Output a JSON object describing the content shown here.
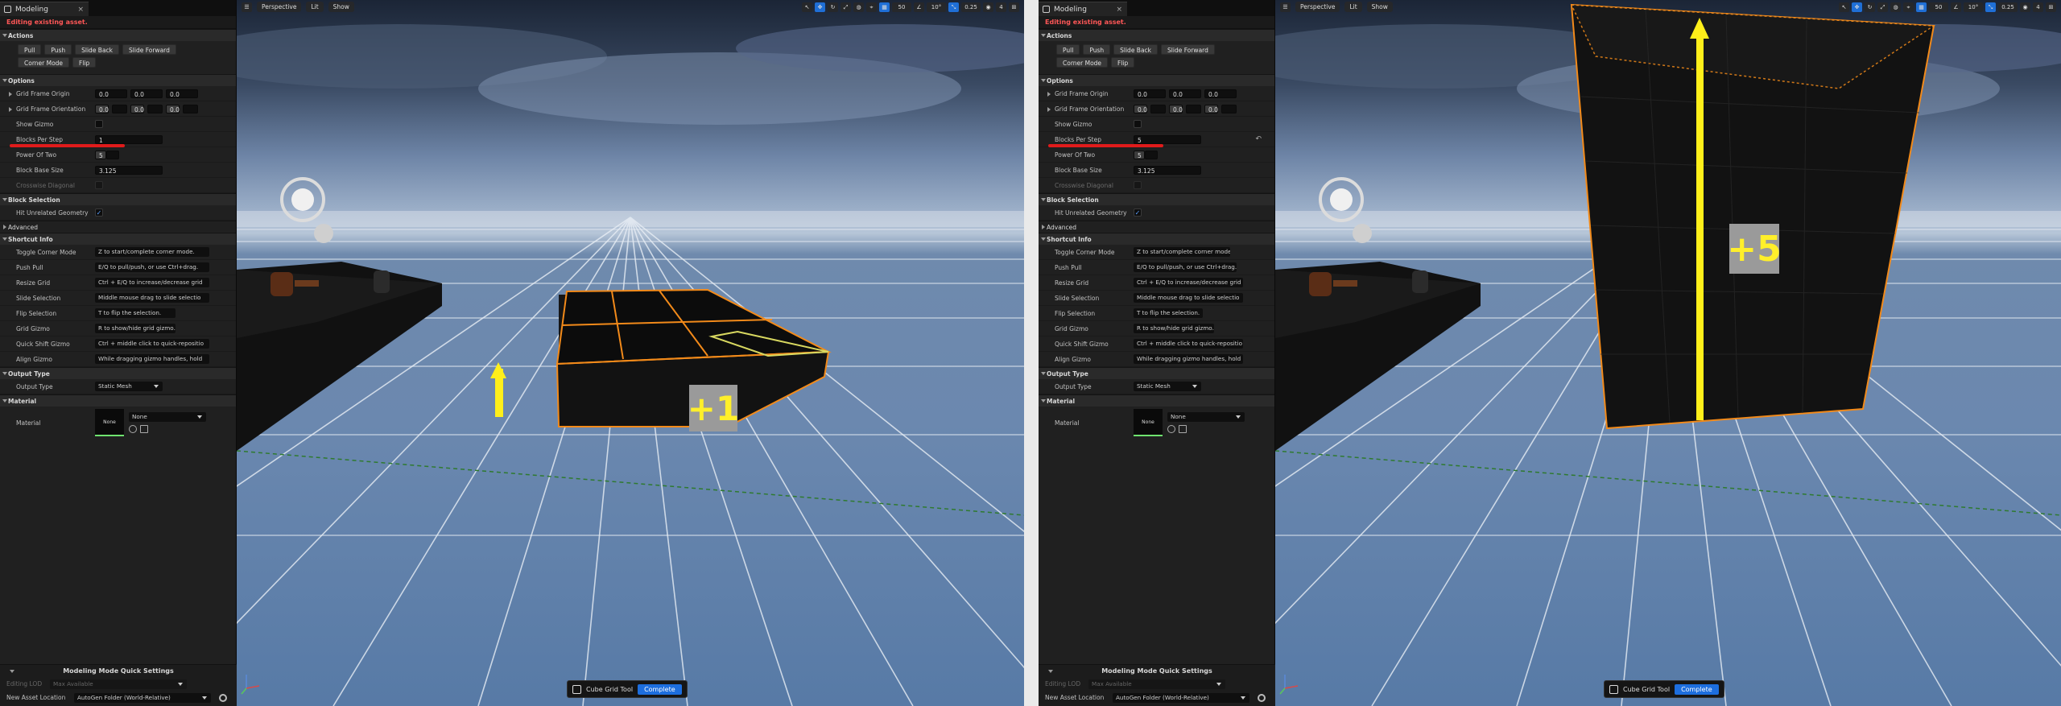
{
  "panel": {
    "tab_title": "Modeling",
    "tab_close": "×",
    "warning": "Editing existing asset.",
    "cat_actions": "Actions",
    "actions_row1": [
      "Pull",
      "Push",
      "Slide Back",
      "Slide Forward"
    ],
    "actions_row2": [
      "Corner Mode",
      "Flip"
    ],
    "cat_options": "Options",
    "grid_frame_origin": "Grid Frame Origin",
    "grid_frame_orientation": "Grid Frame Orientation",
    "zero": "0.0",
    "show_gizmo": "Show Gizmo",
    "blocks_per_step": "Blocks Per Step",
    "power_of_two": "Power Of Two",
    "power_of_two_value": "5",
    "block_base_size": "Block Base Size",
    "block_base_size_value": "3.125",
    "crosswise_diagonal": "Crosswise Diagonal",
    "cat_block_selection": "Block Selection",
    "hit_unrelated": "Hit Unrelated Geometry",
    "cat_advanced": "Advanced",
    "cat_shortcut": "Shortcut Info",
    "shortcuts": [
      {
        "label": "Toggle Corner Mode",
        "value": "Z to start/complete corner mode."
      },
      {
        "label": "Push Pull",
        "value": "E/Q to pull/push, or use Ctrl+drag."
      },
      {
        "label": "Resize Grid",
        "value": "Ctrl + E/Q to increase/decrease grid"
      },
      {
        "label": "Slide Selection",
        "value": "Middle mouse drag to slide selectio"
      },
      {
        "label": "Flip Selection",
        "value": "T to flip the selection."
      },
      {
        "label": "Grid Gizmo",
        "value": "R to show/hide grid gizmo."
      },
      {
        "label": "Quick Shift Gizmo",
        "value": "Ctrl + middle click to quick-repositio"
      },
      {
        "label": "Align Gizmo",
        "value": "While dragging gizmo handles, hold"
      }
    ],
    "cat_output_type": "Output Type",
    "output_type_label": "Output Type",
    "output_type_value": "Static Mesh",
    "cat_material": "Material",
    "material_label": "Material",
    "material_thumb": "None",
    "material_value": "None",
    "quick_title": "Modeling Mode Quick Settings",
    "editing_lod_label": "Editing LOD",
    "editing_lod_value": "Max Available",
    "new_asset_label": "New Asset Location",
    "new_asset_value": "AutoGen Folder (World-Relative)"
  },
  "viewport": {
    "perspective": "Perspective",
    "lit": "Lit",
    "show": "Show",
    "grid_snap": "50",
    "rot_snap": "10°",
    "scale_snap": "0.25",
    "cam_speed": "4",
    "tool_name": "Cube Grid Tool",
    "complete": "Complete"
  },
  "left": {
    "blocks_per_step_value": "1",
    "badge": "+1"
  },
  "right": {
    "blocks_per_step_value": "5",
    "badge": "+5",
    "reset_icon": "↶"
  },
  "colors": {
    "highlight_red": "#e01b1b",
    "arrow_yellow": "#ffef1a",
    "accent_blue": "#1d6ede",
    "selection_orange": "#f28a1a"
  }
}
